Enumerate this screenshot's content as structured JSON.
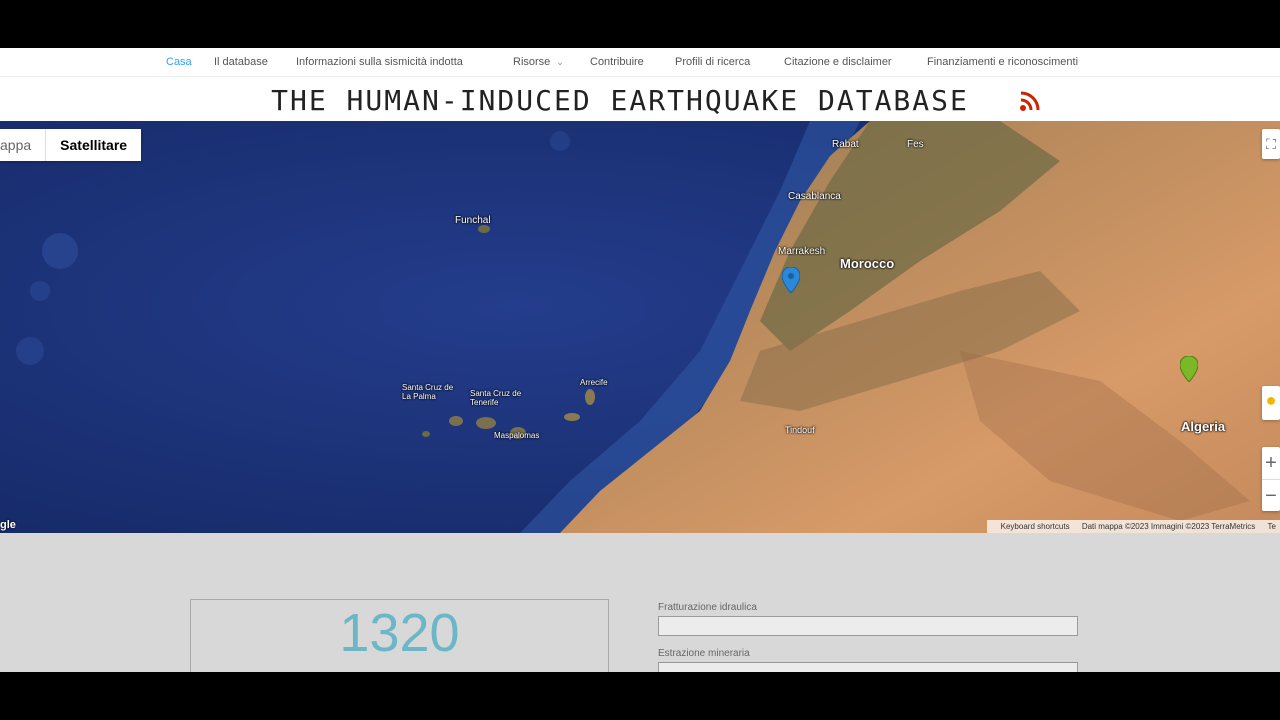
{
  "nav": {
    "items": [
      {
        "label": "Casa",
        "active": true
      },
      {
        "label": "Il database"
      },
      {
        "label": "Informazioni sulla sismicità indotta"
      },
      {
        "label": "Risorse",
        "dropdown": true
      },
      {
        "label": "Contribuire"
      },
      {
        "label": "Profili di ricerca"
      },
      {
        "label": "Citazione e disclaimer"
      },
      {
        "label": "Finanziamenti e riconoscimenti"
      }
    ]
  },
  "header": {
    "title": "THE HUMAN-INDUCED EARTHQUAKE DATABASE",
    "rss_icon": "rss-icon"
  },
  "map": {
    "type_buttons": {
      "map": "appa",
      "satellite": "Satellitare"
    },
    "labels": {
      "rabat": "Rabat",
      "fes": "Fes",
      "casablanca": "Casablanca",
      "marrakesh": "Marrakesh",
      "morocco": "Morocco",
      "algeria": "Algeria",
      "funchal": "Funchal",
      "santa_cruz_palma": "Santa Cruz de La Palma",
      "santa_cruz_tenerife": "Santa Cruz de Tenerife",
      "arrecife": "Arrecife",
      "maspalomas": "Maspalomas",
      "tindouf": "Tindouf"
    },
    "google_mark": "gle",
    "attribution": {
      "shortcuts": "Keyboard shortcuts",
      "data": "Dati mappa ©2023 Immagini ©2023 TerraMetrics",
      "terms": "Te"
    },
    "pin_colors": {
      "blue": "#2b88d8",
      "green": "#7ab828"
    }
  },
  "stats": {
    "count": "1320"
  },
  "filters": {
    "fields": [
      {
        "label": "Fratturazione idraulica",
        "value": ""
      },
      {
        "label": "Estrazione mineraria",
        "value": ""
      }
    ]
  }
}
